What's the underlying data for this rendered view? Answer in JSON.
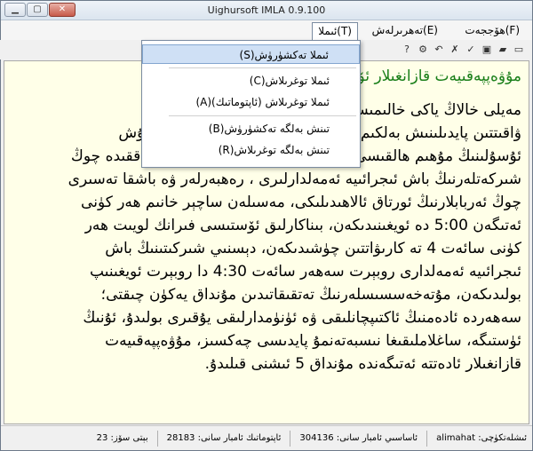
{
  "window": {
    "title": "Uighursoft IMLA 0.9.100"
  },
  "menubar": {
    "items": [
      "ھۆججەت(F)",
      "تەھرىرلەش(E)",
      "ئىملا(T)"
    ]
  },
  "dropdown": {
    "items": [
      "ئىملا تەكشۈرۈش(S)",
      "ئىملا توغرىلاش(C)",
      "ئىملا توغرىلاش (ئاپتوماتىك)(A)",
      "تىنش بەلگە تەكشۈرۈش(B)",
      "تىنش بەلگە توغرىلاش(R)"
    ]
  },
  "document": {
    "lines": [
      "مۇۋەپپەقىيەت قازانغىلار ئۆتكەننى",
      "",
      "مەيلى خالاڭ ياكى خالىمىسىڭىز قازانغىلار ئۆتكەنلىك",
      "ۋاقىتتىن پايدىلىنىش بەلكىم شۇ كۈندىن باشلانغان ساغلام تۇرمۇش",
      "ئۇسۇلىنىڭ مۇھىم ھالقىسى بولسا كېرەك . سەھەر تۇرۇش ھەققىدە چوڭ",
      "شىركەتلەرنىڭ باش ئىجرائىيە ئەمەلدارلىرى ، رەھبەرلەر ۋە باشقا تەسىرى",
      "چوڭ ئەربابلارنىڭ ئورتاق ئالاھىدىلىكى، مەسىلەن ساچېر خانىم ھەر كۈنى",
      "ئەتىگەن 5:00 دە ئويغىنىدىكەن، بىناكارلىق ئۆستىسى فىرانك لويىت ھەر",
      "كۈنى سائەت 4 تە كارىۋاتتىن چۈشىدىكەن، دېسنىي شىركىتىنىڭ باش",
      "ئىجرائىيە ئەمەلدارى روبېرت سەھەر سائەت 4:30 دا روبېرت ئويغىنىپ",
      "بولىدىكەن، مۇتەخەسسىسلەرنىڭ تەتقىقاتىدىن مۇنداق يەكۈن چىقتى؛",
      "سەھەردە ئادەمنىڭ ئاكتىپچانلىقى ۋە ئۈنۈمدارلىقى يۇقىرى بولىدۇ، ئۇنىڭ",
      "ئۈستىگە، ساغلاملىقىغا نىسبەتەنمۇ پايدىسى چەكسىز، مۇۋەپپەقىيەت",
      "قازانغىلار ئادەتتە ئەتىگەندە مۇنداق 5 ئىشنى قىلىدۇ."
    ]
  },
  "statusbar": {
    "fields": [
      "ئىشلەتكۈچى: alimahat",
      "ئاساسىي ئامبار سانى: 304136",
      "ئاپتوماتىك ئامبار سانى: 28183",
      "بېتى سۆز: 23"
    ]
  },
  "colors": {
    "editor_bg": "#ffffe8",
    "highlight_text": "#1a7f1a",
    "underline": "#c00000",
    "menu_hover": "#cfe0f5"
  }
}
